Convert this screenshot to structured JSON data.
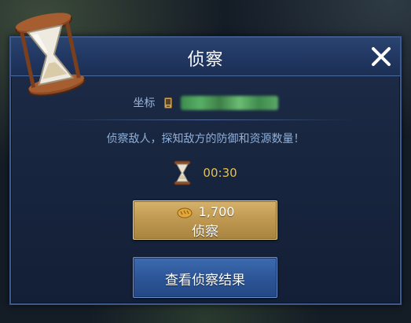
{
  "dialog": {
    "title": "侦察",
    "close_icon": "close-icon"
  },
  "coordinates": {
    "label": "坐标",
    "icon": "phone-icon",
    "value_blurred": true
  },
  "description": "侦察敌人，探知敌方的防御和资源数量！",
  "timer": {
    "icon": "hourglass-icon",
    "value": "00:30"
  },
  "scout_button": {
    "cost_icon": "bread-icon",
    "cost": "1,700",
    "label": "侦察"
  },
  "results_button": {
    "label": "查看侦察结果"
  },
  "colors": {
    "accent_gold": "#c09a52",
    "accent_blue": "#2d5698",
    "timer_text": "#e6c04e",
    "description_text": "#8fb0d8"
  }
}
